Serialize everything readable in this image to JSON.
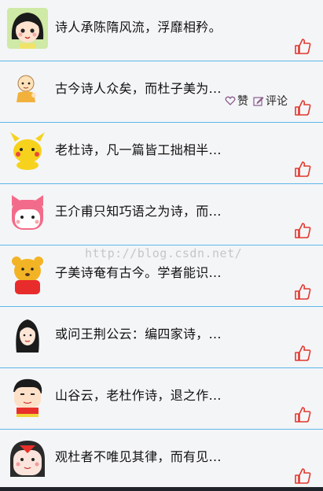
{
  "posts": [
    {
      "avatar": "girl-bob-hair-avatar",
      "text": "诗人承陈隋风流，浮靡相矜。"
    },
    {
      "avatar": "monk-boy-avatar",
      "text": "古今诗人众矣，而杜子美为...",
      "expanded": true
    },
    {
      "avatar": "yellow-pikachu-avatar",
      "text": "老杜诗，凡一篇皆工拙相半..."
    },
    {
      "avatar": "pink-cat-avatar",
      "text": "王介甫只知巧语之为诗，而..."
    },
    {
      "avatar": "winnie-bear-avatar",
      "text": "子美诗奄有古今。学者能识..."
    },
    {
      "avatar": "long-hair-woman-avatar",
      "text": "或问王荆公云：编四家诗，..."
    },
    {
      "avatar": "crayon-shin-avatar",
      "text": "山谷云，老杜作诗，退之作..."
    },
    {
      "avatar": "red-bird-avatar",
      "text": "观杜者不唯见其律，而有见..."
    }
  ],
  "actions": {
    "like_label": "赞",
    "comment_label": "评论"
  },
  "watermark": "http://blog.csdn.net/",
  "colors": {
    "divider": "#5cb8e8",
    "like_icon": "#e2382f",
    "background": "#f4f5f7"
  }
}
